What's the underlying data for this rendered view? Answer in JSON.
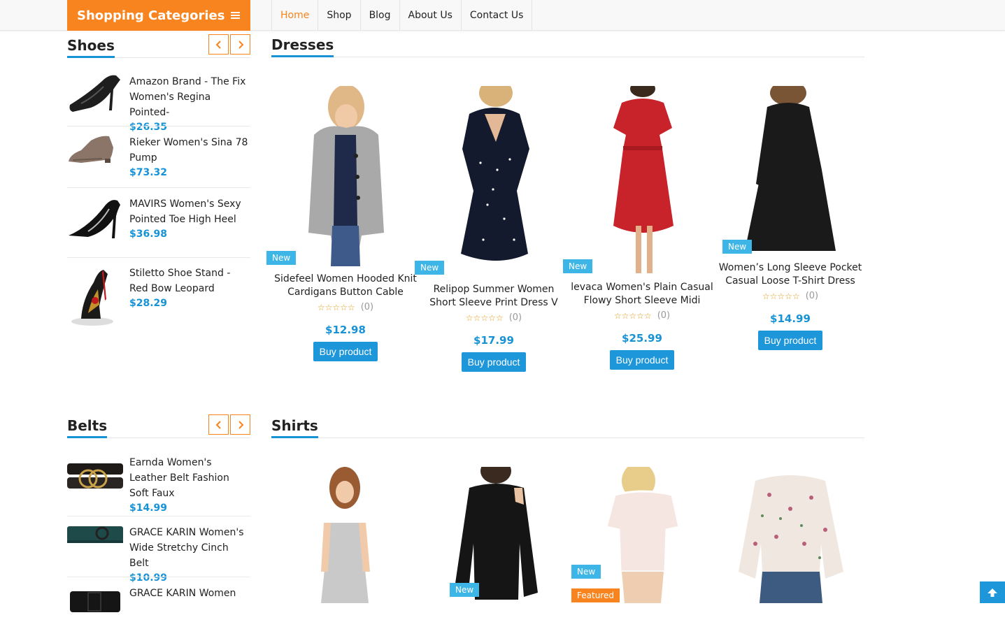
{
  "header": {
    "categories_label": "Shopping Categories",
    "nav": [
      {
        "label": "Home",
        "active": true
      },
      {
        "label": "Shop"
      },
      {
        "label": "Blog"
      },
      {
        "label": "About Us"
      },
      {
        "label": "Contact Us"
      }
    ]
  },
  "sidebar": {
    "shoes": {
      "title": "Shoes",
      "items": [
        {
          "title": "Amazon Brand - The Fix Women's Regina Pointed-",
          "price": "$26.35"
        },
        {
          "title": "Rieker Women's Sina 78 Pump",
          "price": "$73.32"
        },
        {
          "title": "MAVIRS Women's Sexy Pointed Toe High Heel",
          "price": "$36.98"
        },
        {
          "title": "Stiletto Shoe Stand - Red Bow Leopard",
          "price": "$28.29"
        }
      ]
    },
    "belts": {
      "title": "Belts",
      "items": [
        {
          "title": "Earnda Women's Leather Belt Fashion Soft Faux",
          "price": "$14.99"
        },
        {
          "title": "GRACE KARIN Women's Wide Stretchy Cinch Belt",
          "price": "$10.99"
        },
        {
          "title": "GRACE KARIN Women",
          "price": ""
        }
      ]
    }
  },
  "dresses": {
    "title": "Dresses",
    "products": [
      {
        "title": "Sidefeel Women Hooded Knit Cardigans Button Cable",
        "price": "$12.98",
        "rating_count": "(0)",
        "badge": "New",
        "buy": "Buy product"
      },
      {
        "title": "Relipop Summer Women Short Sleeve Print Dress V",
        "price": "$17.99",
        "rating_count": "(0)",
        "badge": "New",
        "buy": "Buy product"
      },
      {
        "title": "levaca Women's Plain Casual Flowy Short Sleeve Midi",
        "price": "$25.99",
        "rating_count": "(0)",
        "badge": "New",
        "buy": "Buy product"
      },
      {
        "title": "Women’s Long Sleeve Pocket Casual Loose T-Shirt Dress",
        "price": "$14.99",
        "rating_count": "(0)",
        "badge": "New",
        "buy": "Buy product"
      }
    ]
  },
  "shirts": {
    "title": "Shirts",
    "badges": {
      "new": "New",
      "featured": "Featured"
    }
  },
  "stars": "☆☆☆☆☆",
  "colors": {
    "accent": "#f7841e",
    "primary": "#1793d5",
    "badge_new": "#3db5e6"
  }
}
